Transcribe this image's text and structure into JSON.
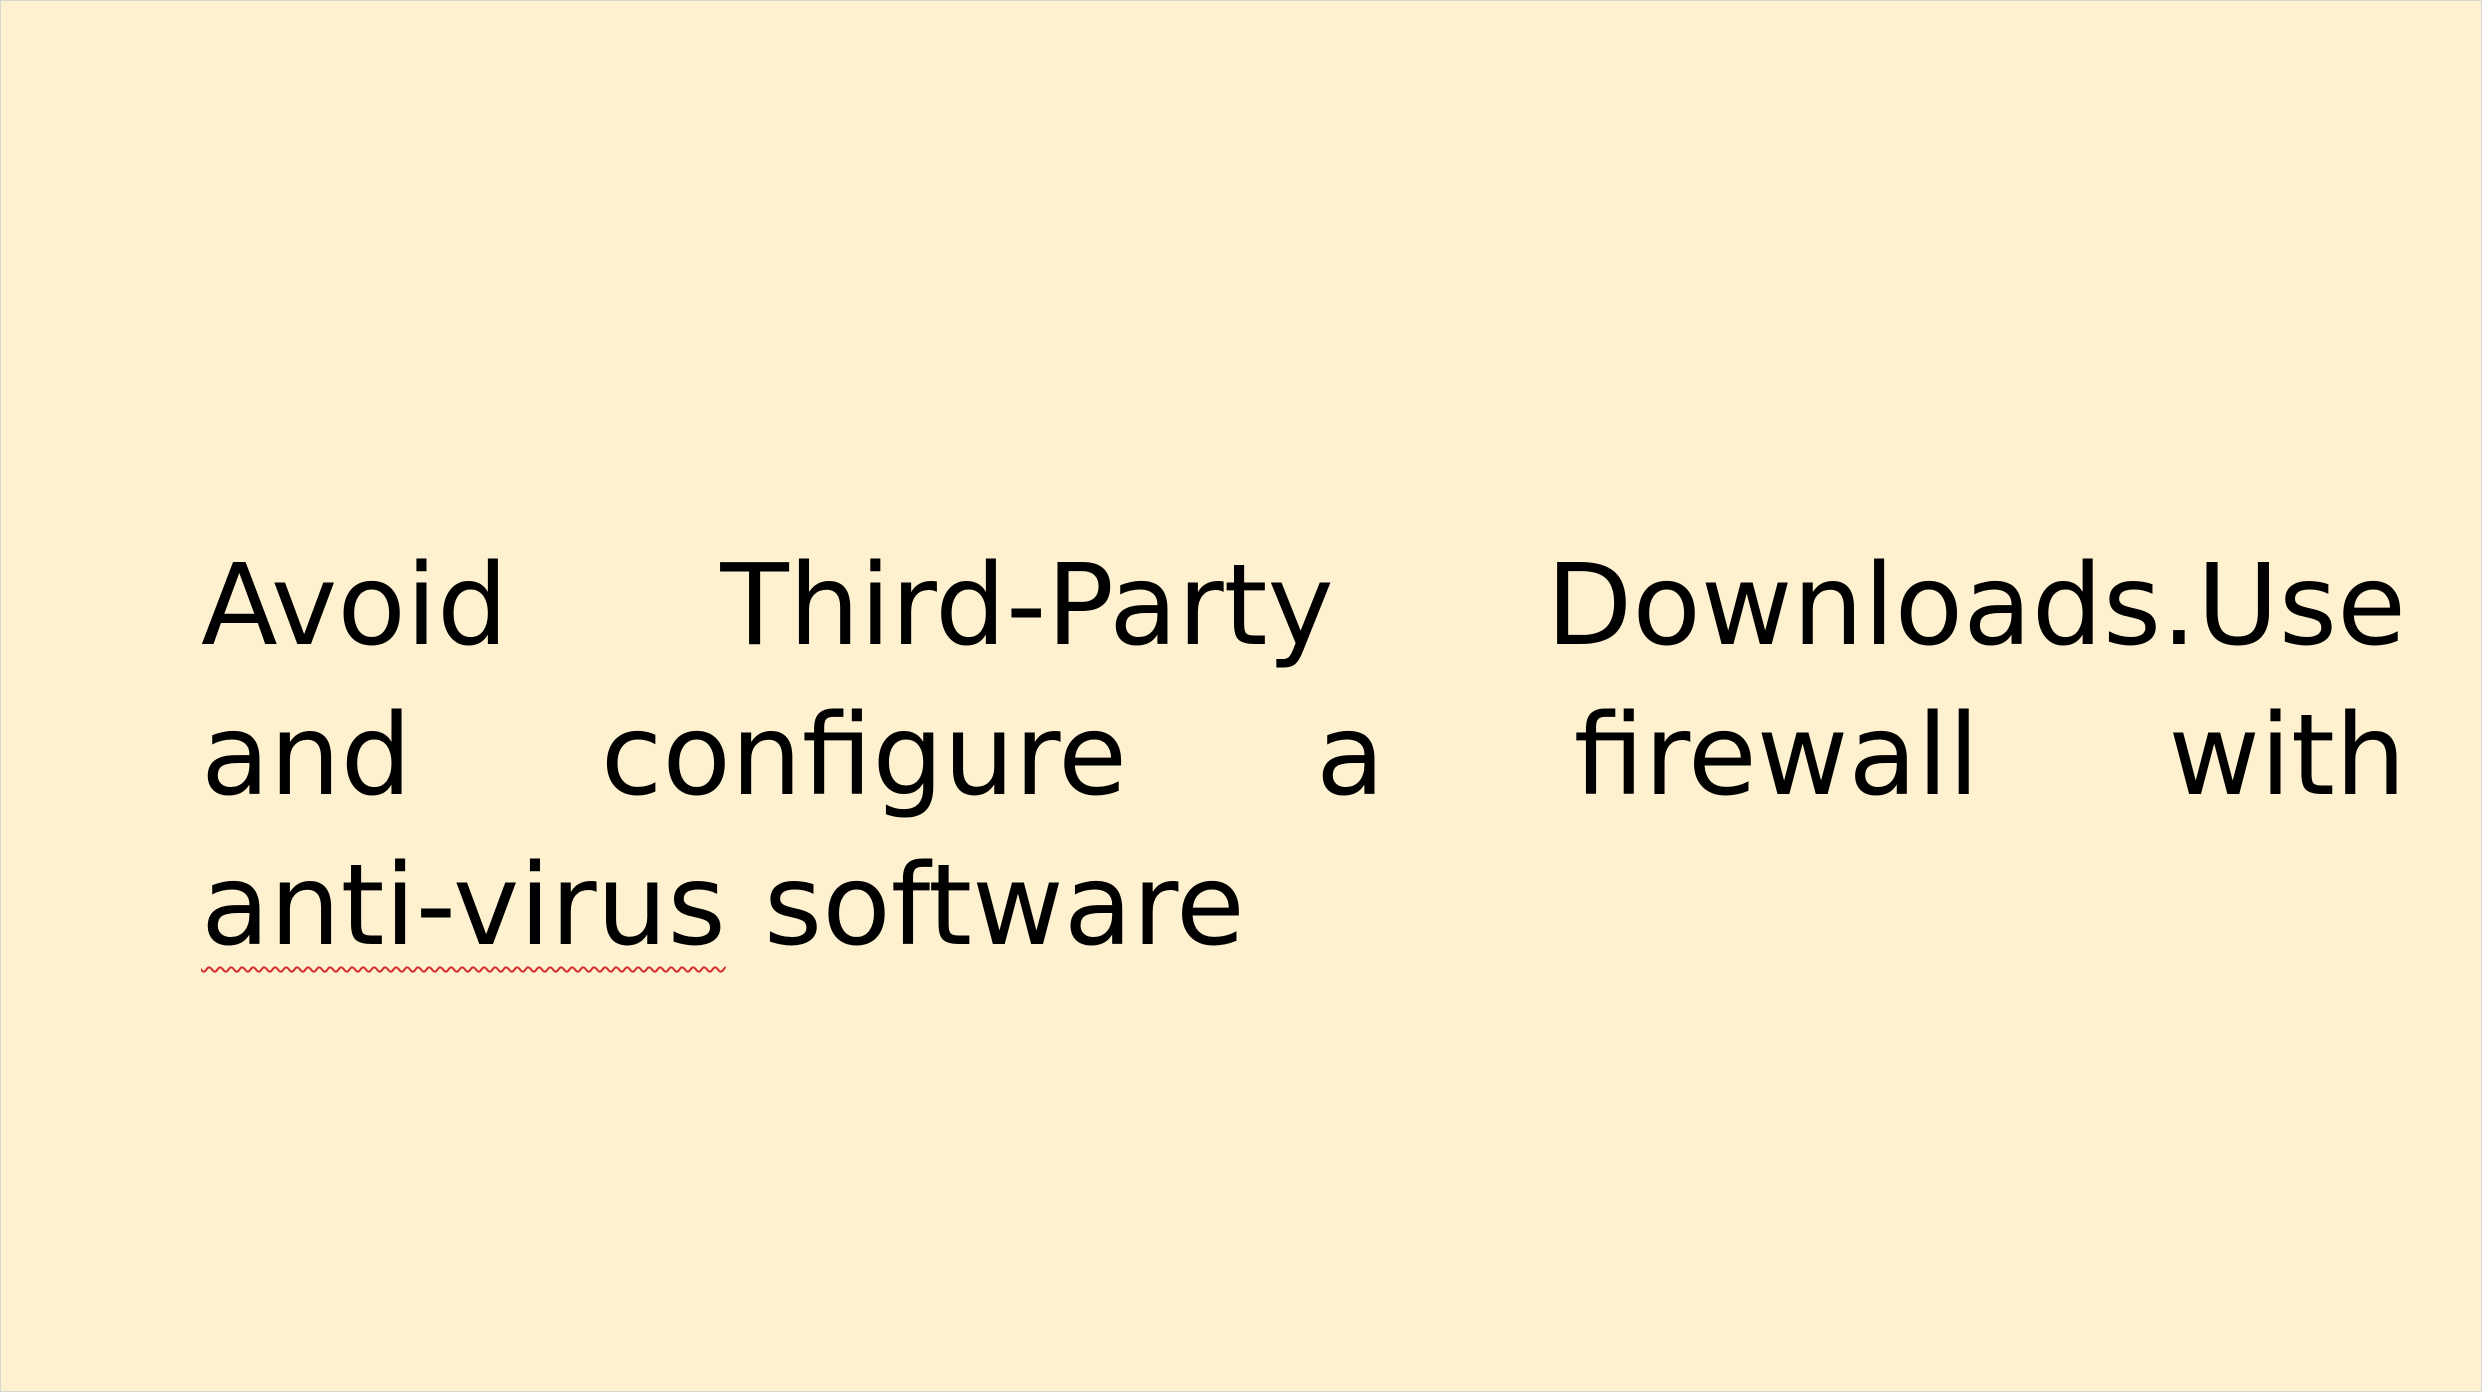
{
  "slide": {
    "background_color": "#fdf1cf",
    "text_color": "#000000",
    "spellcheck_underline_color": "#d32f2f",
    "paragraph": {
      "lines": [
        [
          "Avoid",
          "Third-Party",
          "Downloads.Use"
        ],
        [
          "and",
          "configure",
          "a",
          "firewall",
          "with"
        ],
        [
          "anti-virus",
          "software"
        ]
      ],
      "misspelled_word": "anti-virus"
    }
  }
}
